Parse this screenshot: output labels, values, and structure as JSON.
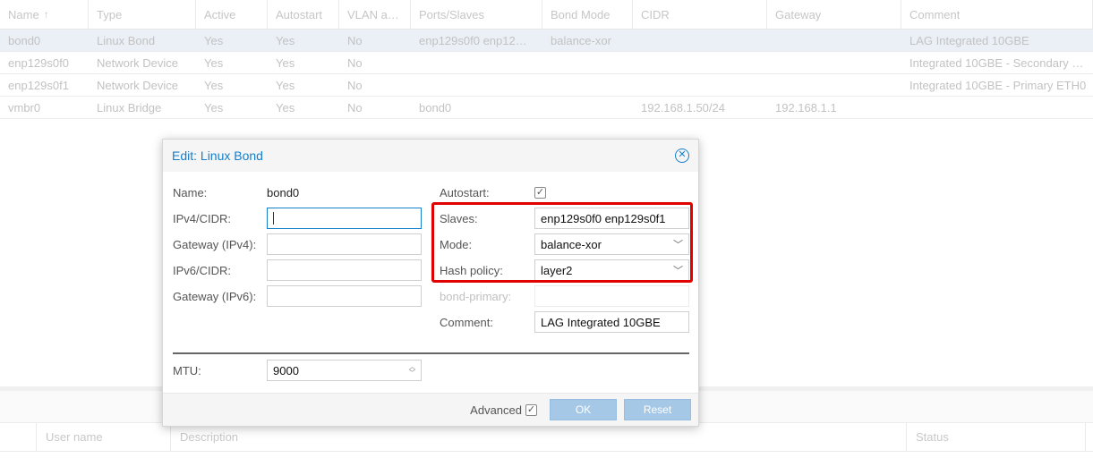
{
  "grid": {
    "columns": [
      "Name",
      "Type",
      "Active",
      "Autostart",
      "VLAN a…",
      "Ports/Slaves",
      "Bond Mode",
      "CIDR",
      "Gateway",
      "Comment"
    ],
    "sort_icon": "sort-up-arrow-icon",
    "rows": [
      [
        "bond0",
        "Linux Bond",
        "Yes",
        "Yes",
        "No",
        "enp129s0f0 enp12…",
        "balance-xor",
        "",
        "",
        "LAG Integrated 10GBE"
      ],
      [
        "enp129s0f0",
        "Network Device",
        "Yes",
        "Yes",
        "No",
        "",
        "",
        "",
        "",
        "Integrated 10GBE - Secondary …"
      ],
      [
        "enp129s0f1",
        "Network Device",
        "Yes",
        "Yes",
        "No",
        "",
        "",
        "",
        "",
        "Integrated 10GBE - Primary ETH0"
      ],
      [
        "vmbr0",
        "Linux Bridge",
        "Yes",
        "Yes",
        "No",
        "bond0",
        "",
        "192.168.1.50/24",
        "192.168.1.1",
        ""
      ]
    ],
    "selected_row": 0
  },
  "lower_grid": {
    "columns": [
      "User name",
      "Description",
      "Status"
    ]
  },
  "dialog": {
    "title": "Edit: Linux Bond",
    "close_icon": "close-circle-icon",
    "left": {
      "name_label": "Name:",
      "name_value": "bond0",
      "ipv4_label": "IPv4/CIDR:",
      "ipv4_value": "",
      "gw4_label": "Gateway (IPv4):",
      "gw4_value": "",
      "ipv6_label": "IPv6/CIDR:",
      "ipv6_value": "",
      "gw6_label": "Gateway (IPv6):",
      "gw6_value": "",
      "mtu_label": "MTU:",
      "mtu_value": "9000"
    },
    "right": {
      "autostart_label": "Autostart:",
      "autostart_checked": true,
      "slaves_label": "Slaves:",
      "slaves_value": "enp129s0f0 enp129s0f1",
      "mode_label": "Mode:",
      "mode_value": "balance-xor",
      "hash_label": "Hash policy:",
      "hash_value": "layer2",
      "bond_primary_label": "bond-primary:",
      "bond_primary_value": "",
      "comment_label": "Comment:",
      "comment_value": "LAG Integrated 10GBE"
    },
    "footer": {
      "advanced_label": "Advanced",
      "advanced_checked": true,
      "ok_label": "OK",
      "reset_label": "Reset"
    }
  },
  "colors": {
    "accent": "#157fcc",
    "highlight_box": "#e00000",
    "button_disabled": "#a5c8e6",
    "selected_row": "#eaf0f6"
  }
}
